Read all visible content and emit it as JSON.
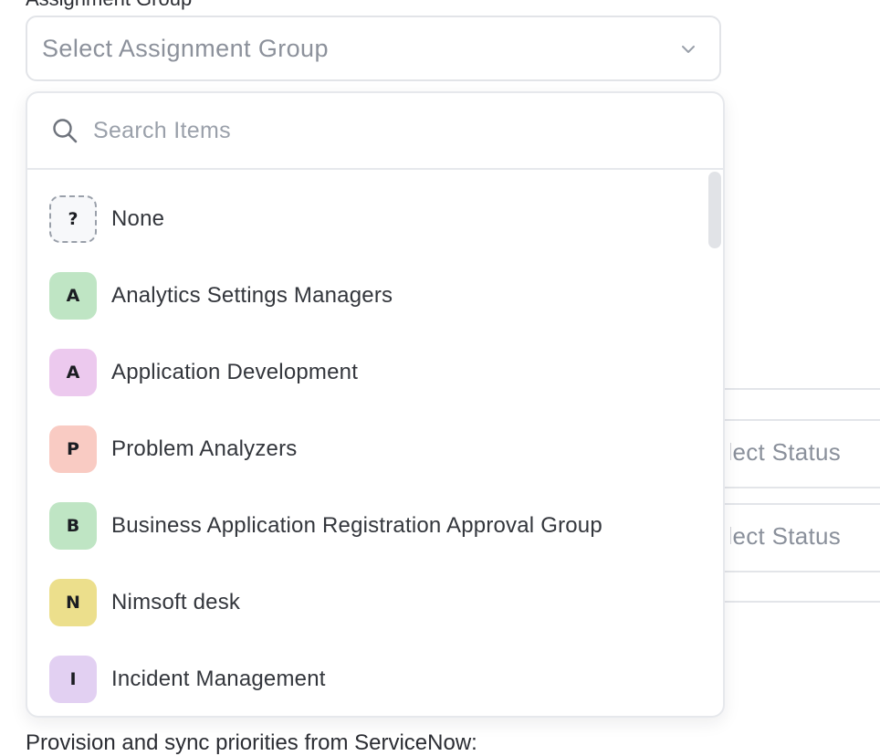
{
  "background": {
    "top_label": "Assignment Group",
    "status_placeholder_1": "Select Status",
    "status_placeholder_2": "Select Status",
    "footer_text": "Provision and sync priorities from ServiceNow:"
  },
  "select": {
    "placeholder": "Select Assignment Group",
    "chevron_icon": "chevron-down-icon"
  },
  "dropdown": {
    "search_placeholder": "Search Items",
    "search_value": "",
    "search_icon": "search-icon",
    "items": [
      {
        "label": "None",
        "initial": "?",
        "color": "#f7f8fa",
        "style": "unknown"
      },
      {
        "label": "Analytics Settings Managers",
        "initial": "A",
        "color": "#bfe5c4"
      },
      {
        "label": "Application Development",
        "initial": "A",
        "color": "#ecc9ee"
      },
      {
        "label": "Problem Analyzers",
        "initial": "P",
        "color": "#f9cbc3"
      },
      {
        "label": "Business Application Registration Approval Group",
        "initial": "B",
        "color": "#bfe5c4"
      },
      {
        "label": "Nimsoft desk",
        "initial": "N",
        "color": "#ecdf8c"
      },
      {
        "label": "Incident Management",
        "initial": "I",
        "color": "#e2d0f2"
      }
    ]
  }
}
